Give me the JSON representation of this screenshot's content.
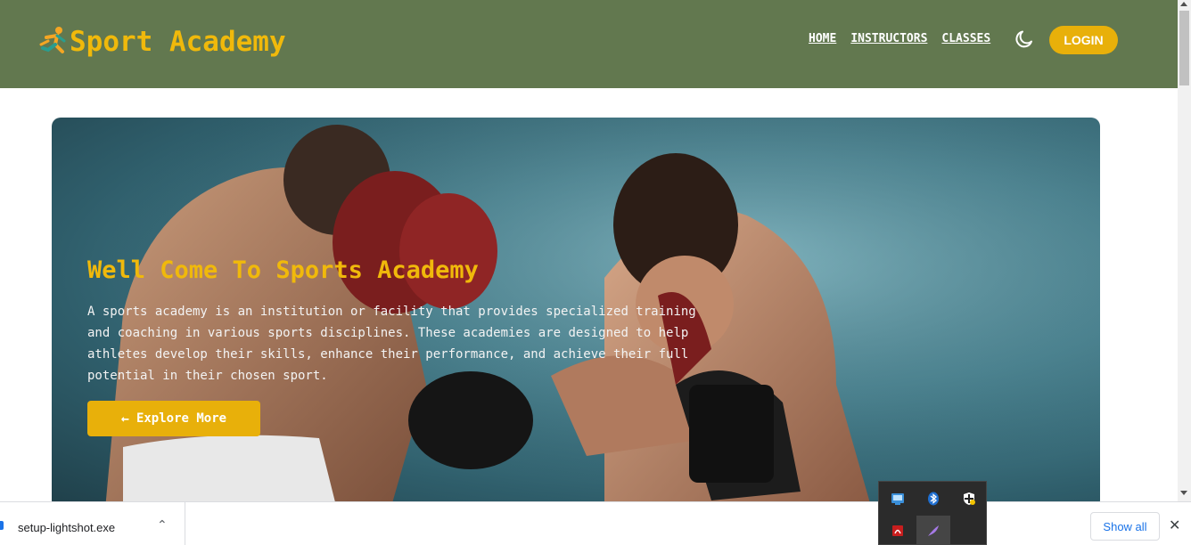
{
  "header": {
    "logo_text": "Sport Academy",
    "logo_icon": "running-person-icon",
    "nav": [
      "HOME",
      "INSTRUCTORS",
      "CLASSES"
    ],
    "theme_toggle_icon": "moon-icon",
    "login_label": "LOGIN"
  },
  "hero": {
    "title": "Well Come To Sports Academy",
    "description": "A sports academy is an institution or facility that provides specialized training and coaching in various sports disciplines. These academies are designed to help athletes develop their skills, enhance their performance, and achieve their full potential in their chosen sport.",
    "button_label": "Explore More",
    "button_icon": "arrow-left-icon"
  },
  "download_bar": {
    "file_name": "setup-lightshot.exe",
    "show_all_label": "Show all",
    "close_icon": "close-icon"
  },
  "tray": {
    "icons": [
      "network-icon",
      "bluetooth-icon",
      "security-shield-icon",
      "pdf-icon",
      "feather-icon"
    ]
  },
  "colors": {
    "header_bg": "#62784f",
    "accent": "#e8b00a",
    "logo": "#f0b90b"
  }
}
